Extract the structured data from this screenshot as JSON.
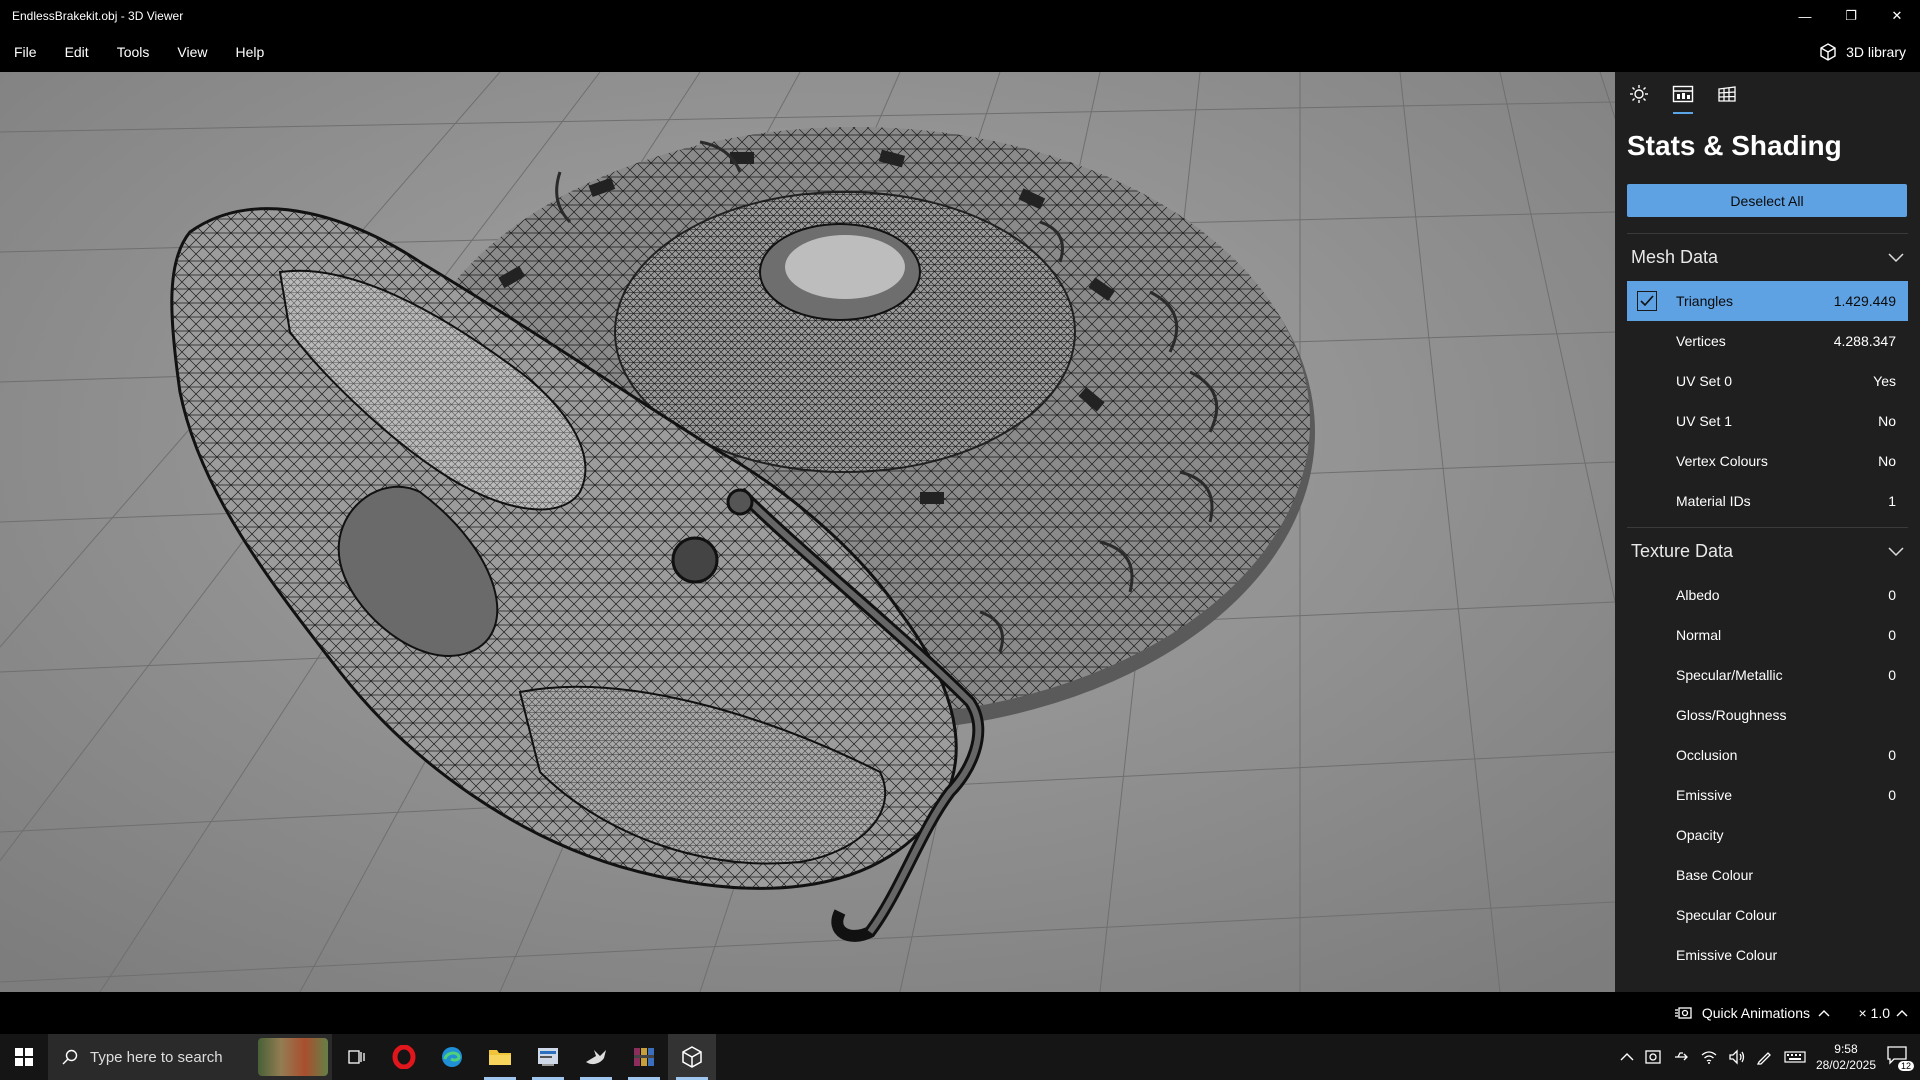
{
  "window": {
    "title": "EndlessBrakekit.obj - 3D Viewer",
    "minimize": "—",
    "restore": "❐",
    "close": "✕"
  },
  "menu": {
    "items": [
      "File",
      "Edit",
      "Tools",
      "View",
      "Help"
    ],
    "library_label": "3D library"
  },
  "panel": {
    "tabs": [
      "lighting-icon",
      "stats-icon",
      "grid-icon"
    ],
    "active_tab": 1,
    "title": "Stats & Shading",
    "deselect_label": "Deselect All",
    "mesh_section": "Mesh Data",
    "mesh_rows": [
      {
        "label": "Triangles",
        "value": "1.429.449",
        "selected": true
      },
      {
        "label": "Vertices",
        "value": "4.288.347"
      },
      {
        "label": "UV Set 0",
        "value": "Yes"
      },
      {
        "label": "UV Set 1",
        "value": "No"
      },
      {
        "label": "Vertex Colours",
        "value": "No"
      },
      {
        "label": "Material IDs",
        "value": "1"
      }
    ],
    "texture_section": "Texture Data",
    "texture_rows": [
      {
        "label": "Albedo",
        "value": "0"
      },
      {
        "label": "Normal",
        "value": "0"
      },
      {
        "label": "Specular/Metallic",
        "value": "0"
      },
      {
        "label": "Gloss/Roughness",
        "value": ""
      },
      {
        "label": "Occlusion",
        "value": "0"
      },
      {
        "label": "Emissive",
        "value": "0"
      },
      {
        "label": "Opacity",
        "value": ""
      },
      {
        "label": "Base Colour",
        "value": ""
      },
      {
        "label": "Specular Colour",
        "value": ""
      },
      {
        "label": "Emissive Colour",
        "value": ""
      }
    ]
  },
  "bottom": {
    "quick_animations": "Quick Animations",
    "speed": "× 1.0"
  },
  "taskbar": {
    "search_placeholder": "Type here to search",
    "time": "9:58",
    "date": "28/02/2025",
    "notifications": "12"
  },
  "colors": {
    "accent": "#5ea2e3",
    "panel_bg": "#1f1f1f",
    "viewport_bg": "#8e8e8e"
  }
}
